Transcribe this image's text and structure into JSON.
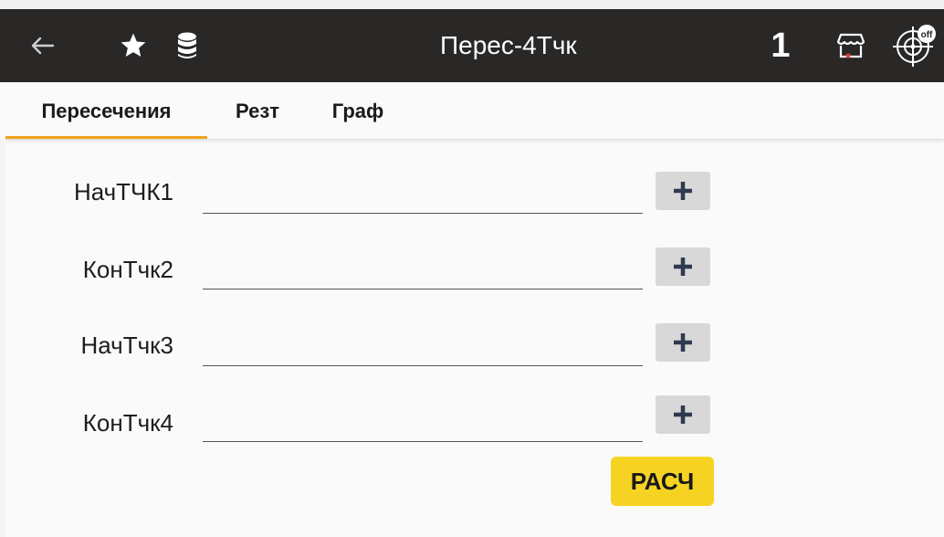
{
  "app": {
    "title": "Перес-4Тчк",
    "count": "1",
    "icons": [
      "back-arrow-icon",
      "star-icon",
      "database-icon",
      "shop-icon",
      "target-off-icon"
    ],
    "target_badge": "off"
  },
  "tabs": [
    {
      "label": "Пересечения",
      "active": true
    },
    {
      "label": "Резт",
      "active": false
    },
    {
      "label": "Граф",
      "active": false
    }
  ],
  "form": {
    "rows": [
      {
        "label": "НачТЧК1",
        "value": ""
      },
      {
        "label": "КонТчк2",
        "value": ""
      },
      {
        "label": "НачТчк3",
        "value": ""
      },
      {
        "label": "КонТчк4",
        "value": ""
      }
    ],
    "calc_label": "РАСЧ"
  },
  "colors": {
    "appbar": "#2a2727",
    "tab_indicator": "#f0a21f",
    "calc_button": "#f6d323",
    "plus_button": "#d8d8d8"
  }
}
